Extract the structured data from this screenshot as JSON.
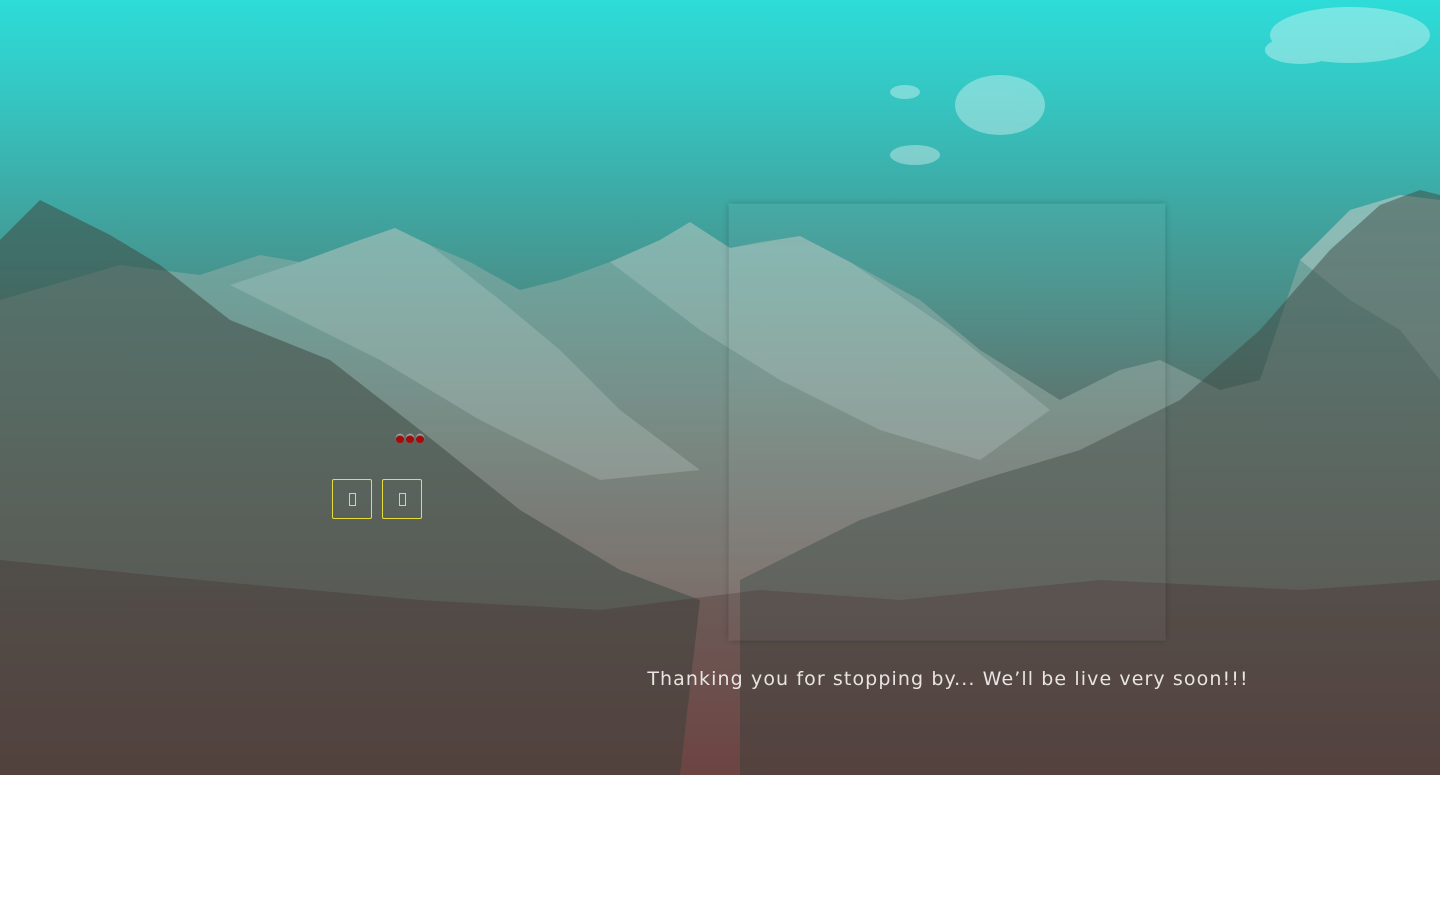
{
  "hero": {
    "background_top_color": "#2ddcd8",
    "background_bottom_color": "#600000",
    "image_subject": "snowy-mountain-range",
    "loading_indicator": {
      "dot_count": 3,
      "dot_color": "#c80000"
    },
    "social_links": [
      {
        "icon": "social-icon-1",
        "color": "#e6dc3c"
      },
      {
        "icon": "social-icon-2",
        "color": "#e6dc3c"
      }
    ],
    "message": "Thanking you for stopping by... We’ll be live very soon!!!"
  }
}
